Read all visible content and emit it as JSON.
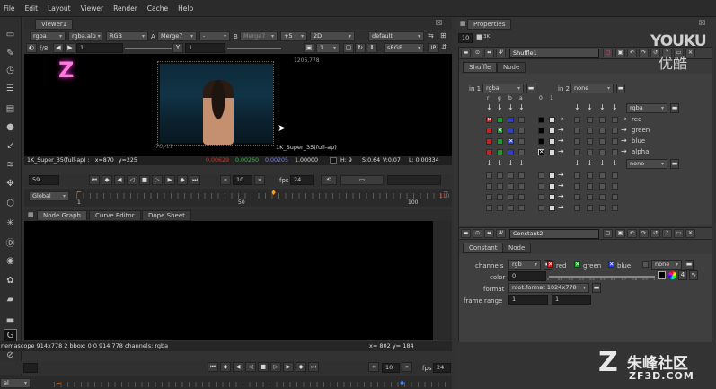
{
  "menubar": {
    "items": [
      "File",
      "Edit",
      "Layout",
      "Viewer",
      "Render",
      "Cache",
      "Help"
    ]
  },
  "viewer": {
    "tab": "Viewer1",
    "channels": "rgba",
    "alpha_channel": "rgba.alp",
    "display": "RGB",
    "a_label": "A",
    "a_input": "Merge7",
    "comp_op": "-",
    "b_label": "B",
    "b_input": "Merge7",
    "gain_label": "+5",
    "mode": "2D",
    "lut_profile": "default",
    "fstop": "f/8",
    "gain_value": "1",
    "gamma_label": "Y",
    "gamma_value": "1",
    "proxy": "1",
    "lut": "sRGB",
    "ip": "IP",
    "format_top_right": "1206,778",
    "format_bottom_left": "-76,-11",
    "format_label": "1K_Super_35(full-ap)",
    "info": {
      "format": "1K_Super_35(full-ap) :",
      "x_label": "x=",
      "x": "870",
      "y_label": "y=",
      "y": "225",
      "r": "0.00629",
      "g": "0.00260",
      "b": "0.00205",
      "a": "1.00000",
      "h": "H: 9",
      "s": "S:0.64",
      "v": "V:0.07",
      "l": "L: 0.00334"
    },
    "colors": {
      "r": "#e0302a",
      "g": "#2fc33b",
      "b": "#5a62ff"
    }
  },
  "playback": {
    "frame": "59",
    "fps_label": "fps",
    "fps": "24",
    "step": "10",
    "range_mode": "Global",
    "ticks": [
      "1",
      "50",
      "100",
      "110"
    ],
    "current_frame_marker": "59"
  },
  "nodegraph": {
    "tabs": [
      "Node Graph",
      "Curve Editor",
      "Dope Sheet"
    ]
  },
  "status": {
    "left": "nemascope 914x778 2 bbox: 0 0 914 778 channels: rgba",
    "right": "x= 802 y= 184"
  },
  "bottom_playback": {
    "step": "10",
    "fps_label": "fps",
    "fps": "24",
    "range_mode": "al"
  },
  "properties": {
    "title": "Properties",
    "max_panels": "10",
    "shuffle": {
      "name": "Shuffle1",
      "tabs": [
        "Shuffle",
        "Node"
      ],
      "in1_label": "in 1",
      "in1": "rgba",
      "in2_label": "in 2",
      "in2": "none",
      "cols": [
        "r",
        "g",
        "b",
        "a",
        "0",
        "1"
      ],
      "out1": "rgba",
      "out2": "none",
      "outputs": [
        "red",
        "green",
        "blue",
        "alpha"
      ]
    },
    "constant": {
      "name": "Constant2",
      "tabs": [
        "Constant",
        "Node"
      ],
      "channels_label": "channels",
      "channels": "rgb",
      "check_red": "red",
      "check_green": "green",
      "check_blue": "blue",
      "check_extra": "none",
      "color_label": "color",
      "color_value": "0",
      "format_label": "format",
      "format": "root.format 1024x778",
      "frame_range_label": "frame range",
      "frame_start": "1",
      "frame_end": "1",
      "slider_ticks": [
        "0",
        "0.1",
        "0.2",
        "0.3",
        "0.4",
        "0.5",
        "0.6",
        "0.7",
        "0.8",
        "0.9",
        "1"
      ],
      "rgba_count": "4"
    }
  },
  "watermarks": {
    "youku_en": "YOUKU",
    "youku_cn": "优酷",
    "zf_cn": "朱峰社区",
    "zf_en": "ZF3D.COM"
  },
  "logo_glyph": "Z"
}
